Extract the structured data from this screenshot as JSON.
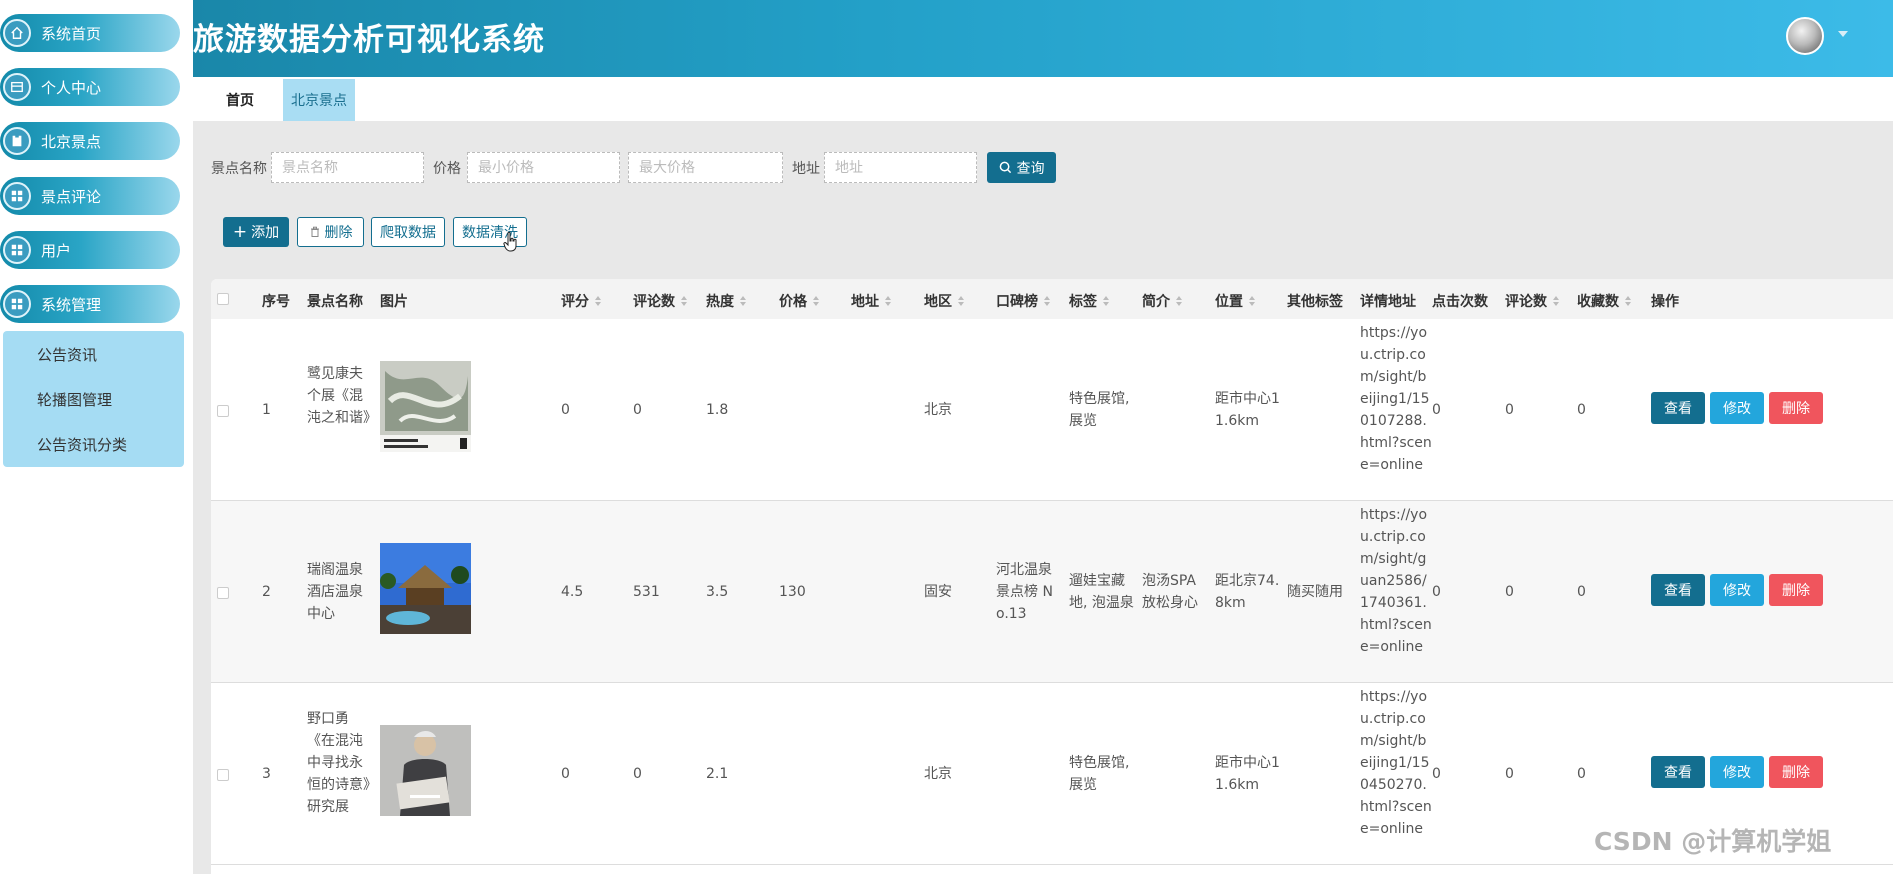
{
  "app": {
    "title": "旅游数据分析可视化系统"
  },
  "sidebar": {
    "items": [
      {
        "label": "系统首页",
        "icon": "home-icon"
      },
      {
        "label": "个人中心",
        "icon": "profile-icon"
      },
      {
        "label": "北京景点",
        "icon": "clipboard-icon"
      },
      {
        "label": "景点评论",
        "icon": "grid-icon"
      },
      {
        "label": "用户",
        "icon": "grid-icon"
      },
      {
        "label": "系统管理",
        "icon": "grid-icon"
      }
    ],
    "subitems": [
      "公告资讯",
      "轮播图管理",
      "公告资讯分类"
    ]
  },
  "tabs": [
    "首页",
    "北京景点"
  ],
  "search": {
    "name_label": "景点名称",
    "name_placeholder": "景点名称",
    "price_label": "价格",
    "min_placeholder": "最小价格",
    "max_placeholder": "最大价格",
    "addr_label": "地址",
    "addr_placeholder": "地址",
    "query_label": "查询"
  },
  "toolbar": {
    "add": "添加",
    "delete": "删除",
    "crawl": "爬取数据",
    "clean": "数据清洗"
  },
  "table": {
    "columns": [
      "序号",
      "景点名称",
      "图片",
      "评分",
      "评论数",
      "热度",
      "价格",
      "地址",
      "地区",
      "口碑榜",
      "标签",
      "简介",
      "位置",
      "其他标签",
      "详情地址",
      "点击次数",
      "评论数",
      "收藏数",
      "操作"
    ],
    "rows": [
      {
        "index": "1",
        "name": "鹭见康夫个展《混沌之和谐》",
        "image": "exhibition-poster",
        "rating": "0",
        "comments": "0",
        "heat": "1.8",
        "price": "",
        "address": "",
        "region": "北京",
        "ranking": "",
        "tags": "特色展馆,展览",
        "intro": "",
        "location": "距市中心11.6km",
        "other_tags": "",
        "url": "https://you.ctrip.com/sight/beijing1/150107288.html?scene=online",
        "clicks": "0",
        "comment_count": "0",
        "favorites": "0"
      },
      {
        "index": "2",
        "name": "瑞阁温泉酒店温泉中心",
        "image": "hot-spring-photo",
        "rating": "4.5",
        "comments": "531",
        "heat": "3.5",
        "price": "130",
        "address": "",
        "region": "固安",
        "ranking": "河北温泉景点榜 No.13",
        "tags": "遛娃宝藏地, 泡温泉",
        "intro": "泡汤SPA放松身心",
        "location": "距北京74.8km",
        "other_tags": "随买随用",
        "url": "https://you.ctrip.com/sight/guan2586/1740361.html?scene=online",
        "clicks": "0",
        "comment_count": "0",
        "favorites": "0"
      },
      {
        "index": "3",
        "name": "野口勇《在混沌中寻找永恒的诗意》研究展",
        "image": "artist-portrait",
        "rating": "0",
        "comments": "0",
        "heat": "2.1",
        "price": "",
        "address": "",
        "region": "北京",
        "ranking": "",
        "tags": "特色展馆,展览",
        "intro": "",
        "location": "距市中心11.6km",
        "other_tags": "",
        "url": "https://you.ctrip.com/sight/beijing1/150450270.html?scene=online",
        "clicks": "0",
        "comment_count": "0",
        "favorites": "0"
      }
    ],
    "actions": {
      "view": "查看",
      "edit": "修改",
      "delete": "删除"
    }
  },
  "watermark": "CSDN @计算机学姐",
  "colors": {
    "primary": "#136e8f",
    "edit": "#23a6dc",
    "danger": "#f0555d",
    "header": "#23a0c8"
  }
}
